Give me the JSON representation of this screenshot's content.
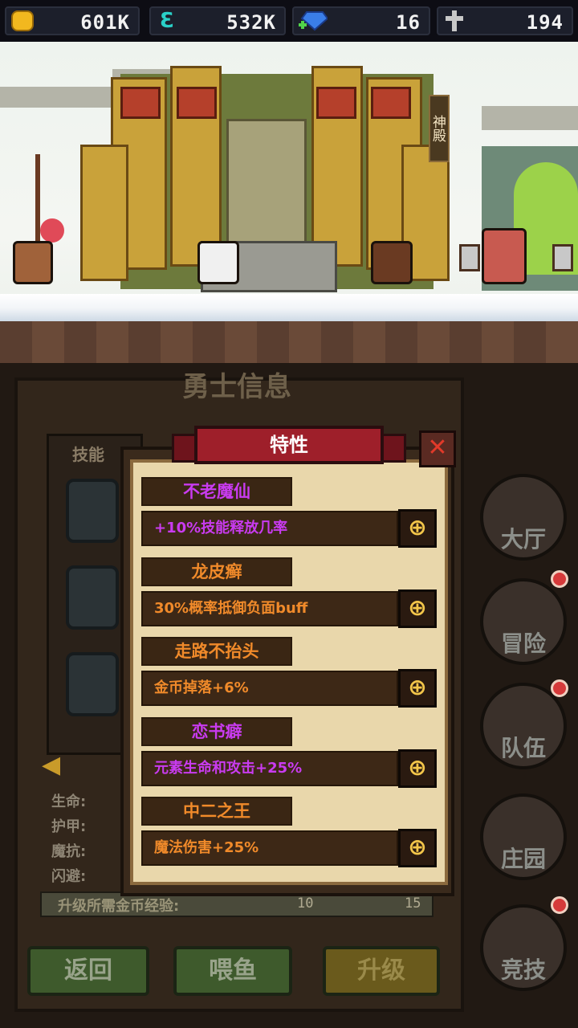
{
  "currency": {
    "gold": "601K",
    "element": "532K",
    "gems": "16",
    "cross": "194"
  },
  "scene": {
    "sign": "神殿"
  },
  "background_panel": {
    "title": "勇士信息",
    "skills_label": "技能",
    "stats": [
      "生命:",
      "护甲:",
      "魔抗:",
      "闪避:"
    ],
    "exp_label": "升级所需金币经验:",
    "exp_gold": "10",
    "exp_element": "15"
  },
  "bottom_buttons": {
    "back": "返回",
    "feed": "喂鱼",
    "upgrade": "升级"
  },
  "side_menu": [
    {
      "label": "大厅"
    },
    {
      "label": "冒险"
    },
    {
      "label": "队伍"
    },
    {
      "label": "庄园"
    },
    {
      "label": "竞技"
    }
  ],
  "dialog": {
    "title": "特性",
    "close_glyph": "✕",
    "traits": [
      {
        "name": "不老魔仙",
        "effect": "+10%技能释放几率",
        "name_color": "#c93bf0",
        "effect_color": "#c93bf0"
      },
      {
        "name": "龙皮癣",
        "effect": "30%概率抵御负面buff",
        "name_color": "#f08a2a",
        "effect_color": "#f08a2a"
      },
      {
        "name": "走路不抬头",
        "effect": "金币掉落+6%",
        "name_color": "#f08a2a",
        "effect_color": "#f08a2a"
      },
      {
        "name": "恋书癖",
        "effect": "元素生命和攻击+25%",
        "name_color": "#c93bf0",
        "effect_color": "#c93bf0"
      },
      {
        "name": "中二之王",
        "effect": "魔法伤害+25%",
        "name_color": "#f08a2a",
        "effect_color": "#f08a2a"
      }
    ],
    "action_glyph": "⊕"
  },
  "colors": {
    "accent_gold": "#f3c64a",
    "ribbon_red": "#9e1f2a",
    "parchment": "#e9d7ab"
  }
}
